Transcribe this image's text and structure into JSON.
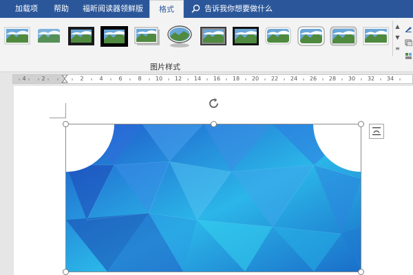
{
  "ribbon_tabs": [
    {
      "label": "加载项",
      "active": false
    },
    {
      "label": "帮助",
      "active": false
    },
    {
      "label": "福昕阅读器领鲜版",
      "active": false
    },
    {
      "label": "格式",
      "active": true
    }
  ],
  "tell_me": {
    "icon": "search-icon",
    "text": "告诉我你想要做什么"
  },
  "picture_styles": {
    "group_label": "图片样式",
    "gallery": [
      {
        "style": "simple-frame-white",
        "icon": "picture-style-icon"
      },
      {
        "style": "soft-edge",
        "icon": "picture-style-icon"
      },
      {
        "style": "thick-frame-black",
        "icon": "picture-style-icon"
      },
      {
        "style": "black-border-shadow",
        "icon": "picture-style-icon"
      },
      {
        "style": "drop-shadow",
        "icon": "picture-style-icon"
      },
      {
        "style": "oval-reflection",
        "icon": "picture-style-icon"
      },
      {
        "style": "metal-frame",
        "icon": "picture-style-icon"
      },
      {
        "style": "thin-black-frame",
        "icon": "picture-style-icon"
      },
      {
        "style": "rounded-soft",
        "icon": "picture-style-icon"
      },
      {
        "style": "rounded-frame",
        "icon": "picture-style-icon"
      },
      {
        "style": "beveled-rounded",
        "icon": "picture-style-icon"
      },
      {
        "style": "simple-frame-gray",
        "icon": "picture-style-icon"
      }
    ],
    "scroll_controls": [
      "up-arrow-icon",
      "down-arrow-icon",
      "more-icon"
    ],
    "side_tools": [
      "picture-border-icon",
      "picture-effects-icon",
      "picture-layout-icon"
    ]
  },
  "ruler": {
    "labels": [
      "4",
      "2",
      "2",
      "4",
      "6",
      "8",
      "10",
      "12",
      "14",
      "16",
      "18",
      "20",
      "22",
      "24",
      "26",
      "28",
      "30",
      "32",
      "34"
    ]
  },
  "document": {
    "selected_picture": {
      "icon": "blue-polygon-picture",
      "cropped_shape": "snip-round-corners"
    },
    "rotate_handle_icon": "rotate-icon",
    "layout_options_icon": "layout-options-icon"
  },
  "colors": {
    "accent": "#2b579a",
    "ribbon_bg": "#f3f3f3",
    "page_bg": "#ffffff"
  }
}
